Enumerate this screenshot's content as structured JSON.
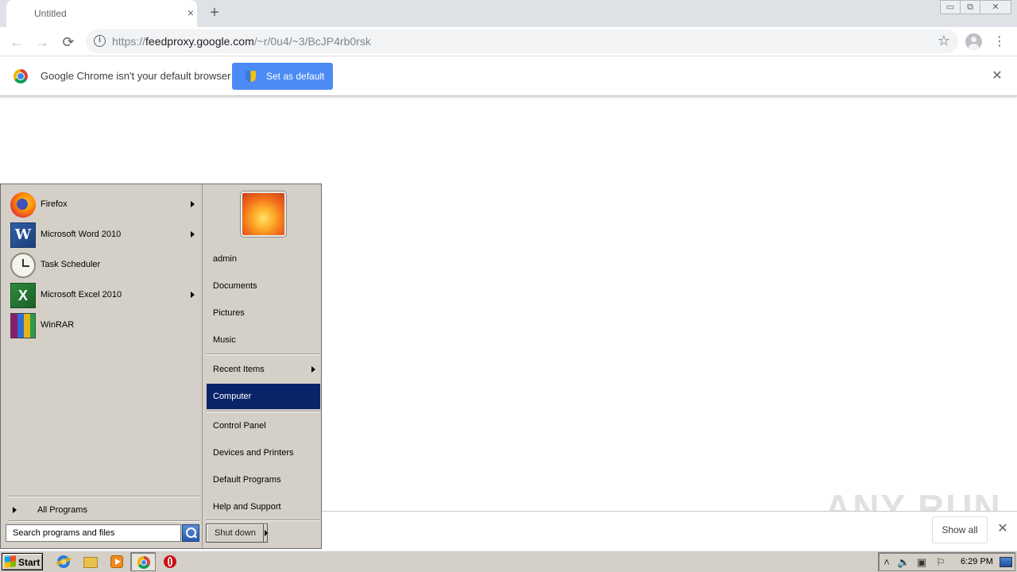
{
  "browser": {
    "tab": {
      "title": "Untitled",
      "close_icon": "×"
    },
    "new_tab_icon": "+",
    "window_controls": {
      "minimize": "▭",
      "restore": "⧉",
      "close": "✕"
    },
    "nav": {
      "back_icon": "←",
      "forward_icon": "→",
      "reload_icon": "⟳"
    },
    "omnibox": {
      "info_icon": "i",
      "url_scheme": "https://",
      "url_host": "feedproxy.google.com",
      "url_path": "/~r/0u4/~3/BcJP4rb0rsk",
      "star_icon": "☆"
    },
    "menu_icon": "⋮"
  },
  "infobar": {
    "message": "Google Chrome isn't your default browser",
    "button_label": "Set as default",
    "close_icon": "✕"
  },
  "download_shelf": {
    "show_all_label": "Show all",
    "close_icon": "✕"
  },
  "watermark": {
    "text": "ANY RUN"
  },
  "start_menu": {
    "programs": [
      {
        "label": "Firefox",
        "icon": "firefox-icon",
        "has_submenu": true
      },
      {
        "label": "Microsoft Word 2010",
        "icon": "word-icon",
        "has_submenu": true
      },
      {
        "label": "Task Scheduler",
        "icon": "task-scheduler-icon",
        "has_submenu": false
      },
      {
        "label": "Microsoft Excel 2010",
        "icon": "excel-icon",
        "has_submenu": true
      },
      {
        "label": "WinRAR",
        "icon": "winrar-icon",
        "has_submenu": false
      }
    ],
    "word_letter": "W",
    "excel_letter": "X",
    "all_programs_label": "All Programs",
    "search_placeholder": "Search programs and files",
    "right_items": {
      "user": "admin",
      "documents": "Documents",
      "pictures": "Pictures",
      "music": "Music",
      "recent_items": "Recent Items",
      "computer": "Computer",
      "control_panel": "Control Panel",
      "devices_printers": "Devices and Printers",
      "default_programs": "Default Programs",
      "help_support": "Help and Support"
    },
    "selected_item": "Computer",
    "shutdown_label": "Shut down"
  },
  "taskbar": {
    "start_label": "Start",
    "pinned": [
      "internet-explorer-icon",
      "explorer-folder-icon",
      "media-player-icon",
      "chrome-icon",
      "opera-icon"
    ],
    "tray": {
      "show_hidden_icon": "˄",
      "volume_icon": "🔈",
      "network_icon": "▣",
      "flag_icon": "⚐",
      "time": "6:29 PM"
    }
  },
  "colors": {
    "chrome_tabstrip": "#dee1e6",
    "set_default_button": "#4c8bf5",
    "start_menu_bg": "#d4d0c8",
    "selected_item_bg": "#0a246a"
  }
}
